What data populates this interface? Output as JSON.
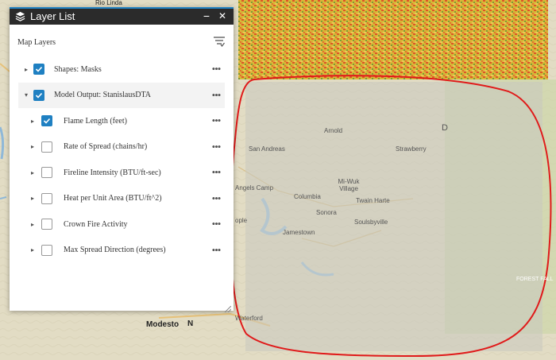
{
  "map": {
    "labels": {
      "rio_linda": "Rio Linda",
      "san_andreas": "San Andreas",
      "arnold": "Arnold",
      "strawberry": "Strawberry",
      "angels_camp": "Angels Camp",
      "columbia": "Columbia",
      "miwuk_village": "Mi-Wuk Village",
      "twain_harte": "Twain Harte",
      "sonora": "Sonora",
      "soulsbyville": "Soulsbyville",
      "jamestown": "Jamestown",
      "modesto": "Modesto",
      "waterford": "Waterford",
      "oakdale": "ople",
      "n_letter": "N",
      "d_letter": "D",
      "forest_fall": "FOREST FALL"
    },
    "colors": {
      "annotation_circle": "#e01a1a",
      "overlay": "#c8c8c0",
      "basemap": "#e6e2cf"
    }
  },
  "panel": {
    "title": "Layer List",
    "minimize_label": "−",
    "close_label": "✕",
    "toolbar_label": "Map Layers",
    "accent_color": "#1f80c2"
  },
  "layers": [
    {
      "label": "Shapes: Masks",
      "checked": true,
      "expanded": false,
      "indent": 0
    },
    {
      "label": "Model Output: StanislausDTA",
      "checked": true,
      "expanded": true,
      "indent": 0
    },
    {
      "label": "Flame Length (feet)",
      "checked": true,
      "expanded": false,
      "indent": 1
    },
    {
      "label": "Rate of Spread (chains/hr)",
      "checked": false,
      "expanded": false,
      "indent": 1
    },
    {
      "label": "Fireline Intensity (BTU/ft-sec)",
      "checked": false,
      "expanded": false,
      "indent": 1
    },
    {
      "label": "Heat per Unit Area (BTU/ft^2)",
      "checked": false,
      "expanded": false,
      "indent": 1
    },
    {
      "label": "Crown Fire Activity",
      "checked": false,
      "expanded": false,
      "indent": 1
    },
    {
      "label": "Max Spread Direction (degrees)",
      "checked": false,
      "expanded": false,
      "indent": 1
    }
  ],
  "icons": {
    "layers": "layers-icon",
    "minimize": "minimize-icon",
    "close": "close-icon",
    "menu": "menu-icon",
    "more": "more-icon"
  }
}
